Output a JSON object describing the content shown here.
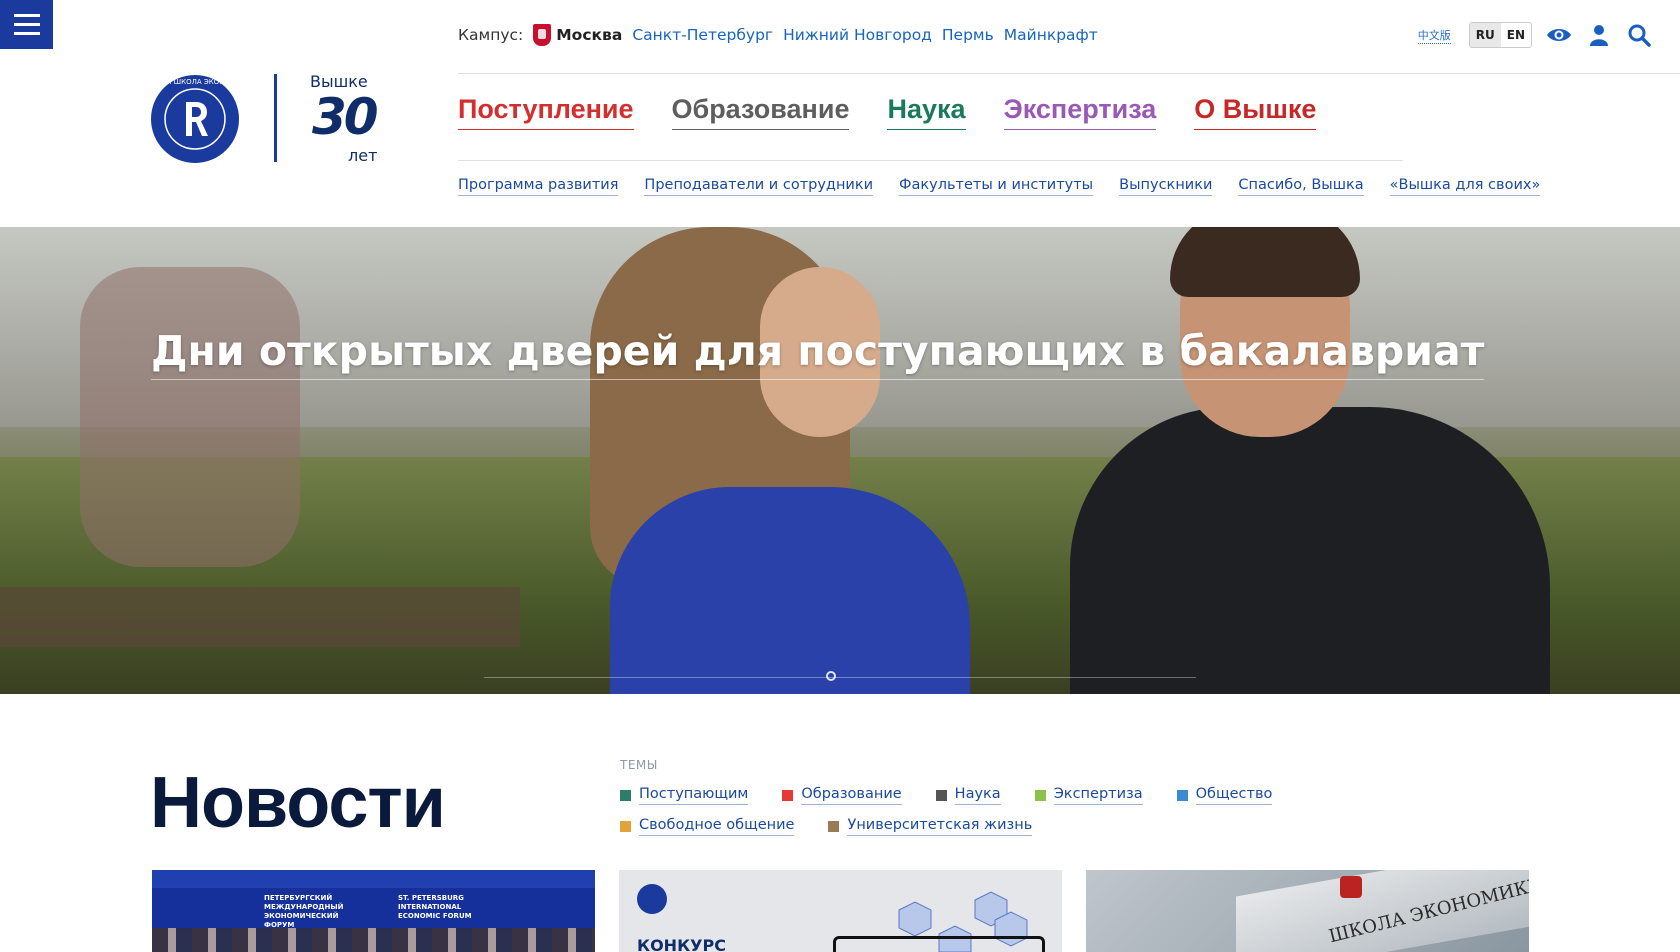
{
  "header": {
    "campus": {
      "label": "Кампус:",
      "current": "Москва",
      "others": [
        "Санкт-Петербург",
        "Нижний Новгород",
        "Пермь",
        "Майнкрафт"
      ]
    },
    "chinese_link": "中文版",
    "languages": [
      "RU",
      "EN"
    ],
    "active_language": "RU",
    "anniversary": {
      "line1": "Вышке",
      "number": "30",
      "line2": "лет"
    },
    "main_nav": [
      {
        "label": "Поступление",
        "color": "#d32f2f"
      },
      {
        "label": "Образование",
        "color": "#5e5e5e"
      },
      {
        "label": "Наука",
        "color": "#1b7a5a"
      },
      {
        "label": "Экспертиза",
        "color": "#9b59b6"
      },
      {
        "label": "О Вышке",
        "color": "#c62828"
      }
    ],
    "sub_nav": [
      "Программа развития",
      "Преподаватели и сотрудники",
      "Факультеты и институты",
      "Выпускники",
      "Спасибо, Вышка",
      "«Вышка для своих»"
    ]
  },
  "hero": {
    "title": "Дни открытых дверей для поступающих в бакалавриат"
  },
  "news": {
    "title": "Новости",
    "topics_label": "ТЕМЫ",
    "topics": [
      {
        "label": "Поступающим",
        "color": "#2e7d6b"
      },
      {
        "label": "Образование",
        "color": "#e53935"
      },
      {
        "label": "Наука",
        "color": "#555555"
      },
      {
        "label": "Экспертиза",
        "color": "#8bc34a"
      },
      {
        "label": "Общество",
        "color": "#3a8bd1"
      },
      {
        "label": "Свободное общение",
        "color": "#e0a43a"
      },
      {
        "label": "Университетская жизнь",
        "color": "#9b7a56"
      }
    ],
    "cards": [
      {
        "caption_left": "ПЕТЕРБУРГСКИЙ МЕЖДУНАРОДНЫЙ ЭКОНОМИЧЕСКИЙ ФОРУМ",
        "caption_right": "ST. PETERSBURG INTERNATIONAL ECONOMIC FORUM"
      },
      {
        "caption": "КОНКУРС"
      },
      {
        "caption": "ШКОЛА ЭКОНОМИКИ"
      }
    ]
  },
  "colors": {
    "brand_blue": "#1a3a9e",
    "dark_navy": "#0f2d69",
    "link_blue": "#1565c0"
  }
}
